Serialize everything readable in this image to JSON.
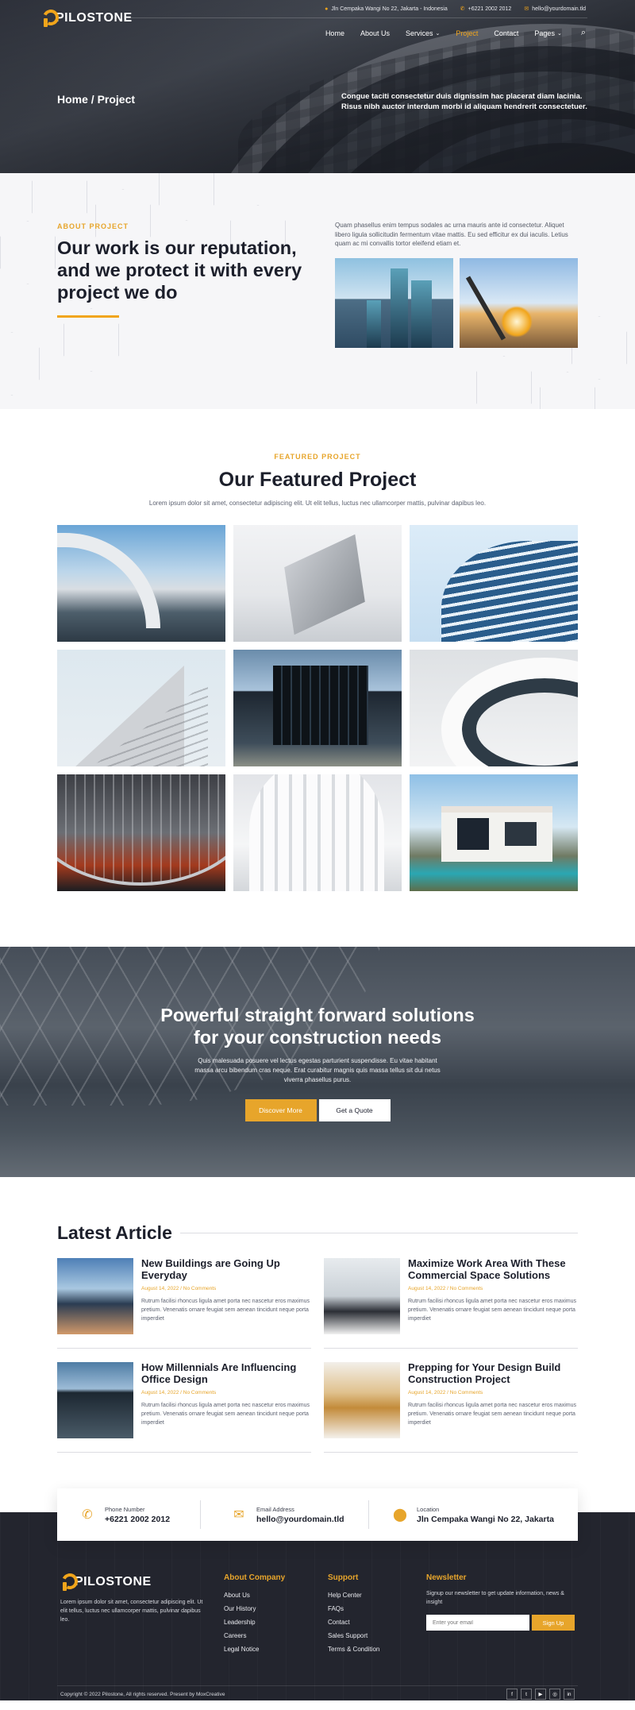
{
  "brand": {
    "name": "PILOSTONE"
  },
  "topbar": {
    "address": "Jln Cempaka Wangi No 22, Jakarta - Indonesia",
    "phone": "+6221 2002 2012",
    "email": "hello@yourdomain.tld"
  },
  "nav": {
    "items": [
      {
        "label": "Home"
      },
      {
        "label": "About Us"
      },
      {
        "label": "Services"
      },
      {
        "label": "Project"
      },
      {
        "label": "Contact"
      },
      {
        "label": "Pages"
      }
    ]
  },
  "hero": {
    "breadcrumb": "Home / Project",
    "text": "Congue taciti consectetur duis dignissim hac placerat diam lacinia. Risus nibh auctor interdum morbi id aliquam hendrerit consectetuer."
  },
  "about": {
    "eyebrow": "ABOUT PROJECT",
    "title": "Our work is our reputation, and we protect it with every project we do",
    "paragraph": "Quam phasellus enim tempus sodales ac urna mauris ante id consectetur. Aliquet libero ligula sollicitudin fermentum vitae mattis. Eu sed efficitur ex dui iaculis. Letius quam ac mi convallis tortor eleifend etiam et."
  },
  "featured": {
    "eyebrow": "FEATURED PROJECT",
    "title": "Our Featured Project",
    "subtitle": "Lorem ipsum dolor sit amet, consectetur adipiscing elit. Ut elit tellus, luctus nec ullamcorper mattis, pulvinar dapibus leo."
  },
  "cta": {
    "title_line1": "Powerful straight forward solutions",
    "title_line2": "for your construction needs",
    "text": "Quis malesuada posuere vel lectus egestas parturient suspendisse. Eu vitae habitant massa arcu bibendum cras neque. Erat curabitur magnis quis massa tellus sit dui netus viverra phasellus purus.",
    "primary_button": "Discover More",
    "secondary_button": "Get a Quote"
  },
  "articles": {
    "title": "Latest Article",
    "items": [
      {
        "title": "New Buildings are Going Up Everyday",
        "meta": "August 14, 2022 / No Comments",
        "excerpt": "Rutrum facilisi rhoncus ligula amet porta nec nascetur eros maximus pretium. Venenatis ornare feugiat sem aenean tincidunt neque porta imperdiet"
      },
      {
        "title": "Maximize Work Area With These Commercial Space Solutions",
        "meta": "August 14, 2022 / No Comments",
        "excerpt": "Rutrum facilisi rhoncus ligula amet porta nec nascetur eros maximus pretium. Venenatis ornare feugiat sem aenean tincidunt neque porta imperdiet"
      },
      {
        "title": "How Millennials Are Influencing Office Design",
        "meta": "August 14, 2022 / No Comments",
        "excerpt": "Rutrum facilisi rhoncus ligula amet porta nec nascetur eros maximus pretium. Venenatis ornare feugiat sem aenean tincidunt neque porta imperdiet"
      },
      {
        "title": "Prepping for Your Design Build Construction Project",
        "meta": "August 14, 2022 / No Comments",
        "excerpt": "Rutrum facilisi rhoncus ligula amet porta nec nascetur eros maximus pretium. Venenatis ornare feugiat sem aenean tincidunt neque porta imperdiet"
      }
    ]
  },
  "contact": {
    "phone_label": "Phone Number",
    "phone_value": "+6221 2002 2012",
    "email_label": "Email Address",
    "email_value": "hello@yourdomain.tld",
    "location_label": "Location",
    "location_value": "Jln Cempaka Wangi No 22, Jakarta"
  },
  "footer": {
    "description": "Lorem ipsum dolor sit amet, consectetur adipiscing elit. Ut elit tellus, luctus nec ullamcorper mattis, pulvinar dapibus leo.",
    "company_title": "About Company",
    "company_links": [
      "About Us",
      "Our History",
      "Leadership",
      "Careers",
      "Legal Notice"
    ],
    "support_title": "Support",
    "support_links": [
      "Help Center",
      "FAQs",
      "Contact",
      "Sales Support",
      "Terms & Condition"
    ],
    "newsletter_title": "Newsletter",
    "newsletter_text": "Signup our newsletter to get update information, news & insight",
    "newsletter_placeholder": "Enter your email",
    "newsletter_button": "Sign Up",
    "copyright": "Copyright © 2022 Pilostone, All rights reserved. Present by MoxCreative",
    "socials": [
      "facebook-icon",
      "twitter-icon",
      "youtube-icon",
      "instagram-icon",
      "linkedin-icon"
    ]
  },
  "colors": {
    "accent": "#e7a52b",
    "dark": "#23252e",
    "text": "#1c1f2b"
  }
}
